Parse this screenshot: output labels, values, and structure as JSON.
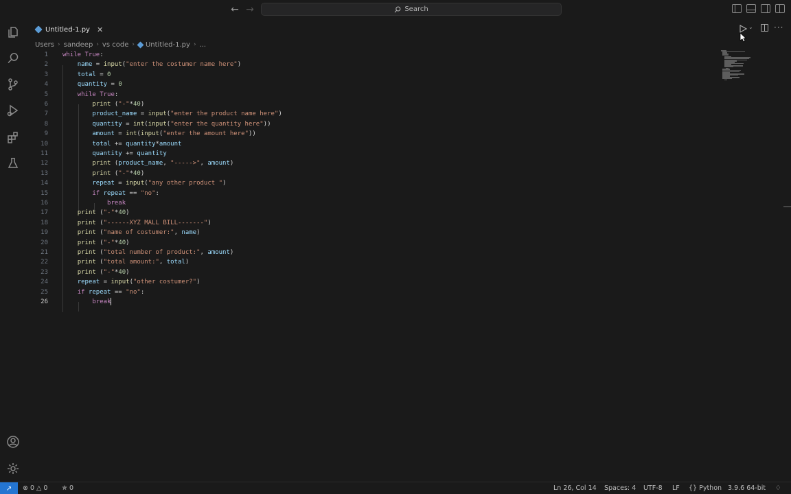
{
  "titlebar": {
    "search_label": "Search"
  },
  "tabs": [
    {
      "label": "Untitled-1.py",
      "active": true
    }
  ],
  "breadcrumb": [
    "Users",
    "sandeep",
    "vs code",
    "Untitled-1.py",
    "..."
  ],
  "editor": {
    "lines": [
      {
        "n": "1",
        "tokens": [
          [
            "kw",
            "while "
          ],
          [
            "kw",
            "True"
          ],
          [
            "tx",
            ":"
          ]
        ]
      },
      {
        "n": "2",
        "tokens": [
          [
            "tx",
            "    "
          ],
          [
            "var",
            "name"
          ],
          [
            "tx",
            " = "
          ],
          [
            "fn",
            "input"
          ],
          [
            "tx",
            "("
          ],
          [
            "str",
            "\"enter the costumer name here\""
          ],
          [
            "tx",
            ")"
          ]
        ]
      },
      {
        "n": "3",
        "tokens": [
          [
            "tx",
            "    "
          ],
          [
            "var",
            "total"
          ],
          [
            "tx",
            " = "
          ],
          [
            "num",
            "0"
          ]
        ]
      },
      {
        "n": "4",
        "tokens": [
          [
            "tx",
            "    "
          ],
          [
            "var",
            "quantity"
          ],
          [
            "tx",
            " = "
          ],
          [
            "num",
            "0"
          ]
        ]
      },
      {
        "n": "5",
        "tokens": [
          [
            "tx",
            "    "
          ],
          [
            "kw",
            "while "
          ],
          [
            "kw",
            "True"
          ],
          [
            "tx",
            ":"
          ]
        ]
      },
      {
        "n": "6",
        "tokens": [
          [
            "tx",
            "        "
          ],
          [
            "fn",
            "print"
          ],
          [
            "tx",
            " ("
          ],
          [
            "str",
            "\"-\""
          ],
          [
            "tx",
            "*"
          ],
          [
            "num",
            "40"
          ],
          [
            "tx",
            ")"
          ]
        ]
      },
      {
        "n": "7",
        "tokens": [
          [
            "tx",
            "        "
          ],
          [
            "var",
            "product_name"
          ],
          [
            "tx",
            " = "
          ],
          [
            "fn",
            "input"
          ],
          [
            "tx",
            "("
          ],
          [
            "str",
            "\"enter the product name here\""
          ],
          [
            "tx",
            ")"
          ]
        ]
      },
      {
        "n": "8",
        "tokens": [
          [
            "tx",
            "        "
          ],
          [
            "var",
            "quantity"
          ],
          [
            "tx",
            " = "
          ],
          [
            "fn",
            "int"
          ],
          [
            "tx",
            "("
          ],
          [
            "fn",
            "input"
          ],
          [
            "tx",
            "("
          ],
          [
            "str",
            "\"enter the quantity here\""
          ],
          [
            "tx",
            "))"
          ]
        ]
      },
      {
        "n": "9",
        "tokens": [
          [
            "tx",
            "        "
          ],
          [
            "var",
            "amount"
          ],
          [
            "tx",
            " = "
          ],
          [
            "fn",
            "int"
          ],
          [
            "tx",
            "("
          ],
          [
            "fn",
            "input"
          ],
          [
            "tx",
            "("
          ],
          [
            "str",
            "\"enter the amount here\""
          ],
          [
            "tx",
            "))"
          ]
        ]
      },
      {
        "n": "10",
        "tokens": [
          [
            "tx",
            "        "
          ],
          [
            "var",
            "total"
          ],
          [
            "tx",
            " += "
          ],
          [
            "var",
            "quantity"
          ],
          [
            "tx",
            "*"
          ],
          [
            "var",
            "amount"
          ]
        ]
      },
      {
        "n": "11",
        "tokens": [
          [
            "tx",
            "        "
          ],
          [
            "var",
            "quantity"
          ],
          [
            "tx",
            " += "
          ],
          [
            "var",
            "quantity"
          ]
        ]
      },
      {
        "n": "12",
        "tokens": [
          [
            "tx",
            "        "
          ],
          [
            "fn",
            "print"
          ],
          [
            "tx",
            " ("
          ],
          [
            "var",
            "product_name"
          ],
          [
            "tx",
            ", "
          ],
          [
            "str",
            "\"----->\""
          ],
          [
            "tx",
            ", "
          ],
          [
            "var",
            "amount"
          ],
          [
            "tx",
            ")"
          ]
        ]
      },
      {
        "n": "13",
        "tokens": [
          [
            "tx",
            "        "
          ],
          [
            "fn",
            "print"
          ],
          [
            "tx",
            " ("
          ],
          [
            "str",
            "\"-\""
          ],
          [
            "tx",
            "*"
          ],
          [
            "num",
            "40"
          ],
          [
            "tx",
            ")"
          ]
        ]
      },
      {
        "n": "14",
        "tokens": [
          [
            "tx",
            "        "
          ],
          [
            "var",
            "repeat"
          ],
          [
            "tx",
            " = "
          ],
          [
            "fn",
            "input"
          ],
          [
            "tx",
            "("
          ],
          [
            "str",
            "\"any other product \""
          ],
          [
            "tx",
            ")"
          ]
        ]
      },
      {
        "n": "15",
        "tokens": [
          [
            "tx",
            "        "
          ],
          [
            "kw",
            "if "
          ],
          [
            "var",
            "repeat"
          ],
          [
            "tx",
            " == "
          ],
          [
            "str",
            "\"no\""
          ],
          [
            "tx",
            ":"
          ]
        ]
      },
      {
        "n": "16",
        "tokens": [
          [
            "tx",
            "            "
          ],
          [
            "kw",
            "break"
          ]
        ]
      },
      {
        "n": "17",
        "tokens": [
          [
            "tx",
            "    "
          ],
          [
            "fn",
            "print"
          ],
          [
            "tx",
            " ("
          ],
          [
            "str",
            "\"-\""
          ],
          [
            "tx",
            "*"
          ],
          [
            "num",
            "40"
          ],
          [
            "tx",
            ")"
          ]
        ]
      },
      {
        "n": "18",
        "tokens": [
          [
            "tx",
            "    "
          ],
          [
            "fn",
            "print"
          ],
          [
            "tx",
            " ("
          ],
          [
            "str",
            "\"------XYZ MALL BILL-------\""
          ],
          [
            "tx",
            ")"
          ]
        ]
      },
      {
        "n": "19",
        "tokens": [
          [
            "tx",
            "    "
          ],
          [
            "fn",
            "print"
          ],
          [
            "tx",
            " ("
          ],
          [
            "str",
            "\"name of costumer:\""
          ],
          [
            "tx",
            ", "
          ],
          [
            "var",
            "name"
          ],
          [
            "tx",
            ")"
          ]
        ]
      },
      {
        "n": "20",
        "tokens": [
          [
            "tx",
            "    "
          ],
          [
            "fn",
            "print"
          ],
          [
            "tx",
            " ("
          ],
          [
            "str",
            "\"-\""
          ],
          [
            "tx",
            "*"
          ],
          [
            "num",
            "40"
          ],
          [
            "tx",
            ")"
          ]
        ]
      },
      {
        "n": "21",
        "tokens": [
          [
            "tx",
            "    "
          ],
          [
            "fn",
            "print"
          ],
          [
            "tx",
            " ("
          ],
          [
            "str",
            "\"total number of product:\""
          ],
          [
            "tx",
            ", "
          ],
          [
            "var",
            "amount"
          ],
          [
            "tx",
            ")"
          ]
        ]
      },
      {
        "n": "22",
        "tokens": [
          [
            "tx",
            "    "
          ],
          [
            "fn",
            "print"
          ],
          [
            "tx",
            " ("
          ],
          [
            "str",
            "\"total amount:\""
          ],
          [
            "tx",
            ", "
          ],
          [
            "var",
            "total"
          ],
          [
            "tx",
            ")"
          ]
        ]
      },
      {
        "n": "23",
        "tokens": [
          [
            "tx",
            "    "
          ],
          [
            "fn",
            "print"
          ],
          [
            "tx",
            " ("
          ],
          [
            "str",
            "\"-\""
          ],
          [
            "tx",
            "*"
          ],
          [
            "num",
            "40"
          ],
          [
            "tx",
            ")"
          ]
        ]
      },
      {
        "n": "24",
        "tokens": [
          [
            "tx",
            "    "
          ],
          [
            "var",
            "repeat"
          ],
          [
            "tx",
            " = "
          ],
          [
            "fn",
            "input"
          ],
          [
            "tx",
            "("
          ],
          [
            "str",
            "\"other costumer?\""
          ],
          [
            "tx",
            ")"
          ]
        ]
      },
      {
        "n": "25",
        "tokens": [
          [
            "tx",
            "    "
          ],
          [
            "kw",
            "if "
          ],
          [
            "var",
            "repeat"
          ],
          [
            "tx",
            " == "
          ],
          [
            "str",
            "\"no\""
          ],
          [
            "tx",
            ":"
          ]
        ]
      },
      {
        "n": "26",
        "tokens": [
          [
            "tx",
            "        "
          ],
          [
            "kw",
            "break"
          ]
        ],
        "active": true
      }
    ]
  },
  "statusbar": {
    "errors": "0",
    "warnings": "0",
    "ports": "0",
    "position": "Ln 26, Col 14",
    "spaces": "Spaces: 4",
    "encoding": "UTF-8",
    "eol": "LF",
    "language": "Python",
    "interpreter": "3.9.6 64-bit"
  },
  "colors": {
    "background": "#1a1a1a",
    "keyword": "#c586c0",
    "function": "#dcdcaa",
    "string": "#ce9178",
    "number": "#b5cea8",
    "variable": "#9cdcfe",
    "remote_button": "#2475d1"
  },
  "icons": {
    "activity_bar": [
      "files-icon",
      "search-icon",
      "source-control-icon",
      "run-debug-icon",
      "extensions-icon",
      "testing-icon",
      "account-icon",
      "settings-gear-icon"
    ]
  }
}
